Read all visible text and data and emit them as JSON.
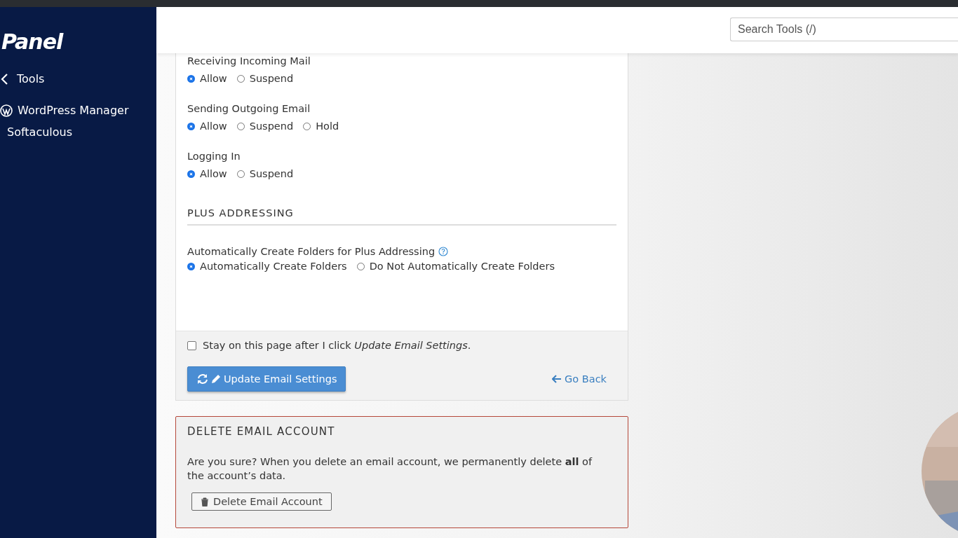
{
  "sidebar": {
    "logo": "Panel",
    "items": [
      {
        "kind": "back",
        "label": "Tools"
      },
      {
        "kind": "wordpress",
        "label": "WordPress Manager"
      },
      {
        "kind": "plain",
        "label": "Softaculous"
      }
    ]
  },
  "header": {
    "search": {
      "placeholder": "Search Tools (/)"
    }
  },
  "settings": [
    {
      "label": "Receiving Incoming Mail",
      "options": [
        {
          "label": "Allow",
          "selected": true
        },
        {
          "label": "Suspend",
          "selected": false
        }
      ]
    },
    {
      "label": "Sending Outgoing Email",
      "options": [
        {
          "label": "Allow",
          "selected": true
        },
        {
          "label": "Suspend",
          "selected": false
        },
        {
          "label": "Hold",
          "selected": false
        }
      ]
    },
    {
      "label": "Logging In",
      "options": [
        {
          "label": "Allow",
          "selected": true
        },
        {
          "label": "Suspend",
          "selected": false
        }
      ]
    }
  ],
  "plus_addressing": {
    "heading": "PLUS ADDRESSING",
    "label": "Automatically Create Folders for Plus Addressing",
    "options": [
      {
        "label": "Automatically Create Folders",
        "selected": true
      },
      {
        "label": "Do Not Automatically Create Folders",
        "selected": false
      }
    ]
  },
  "footer": {
    "stay_checkbox": {
      "label": "Stay on this page after I click *Update Email Settings*.",
      "checked": false
    },
    "update_button": "Update Email Settings",
    "back_link": "Go Back"
  },
  "delete": {
    "heading": "DELETE EMAIL ACCOUNT",
    "text": "Are you sure? When you delete an email account, we permanently delete **all** of the account’s data.",
    "button": "Delete Email Account"
  }
}
